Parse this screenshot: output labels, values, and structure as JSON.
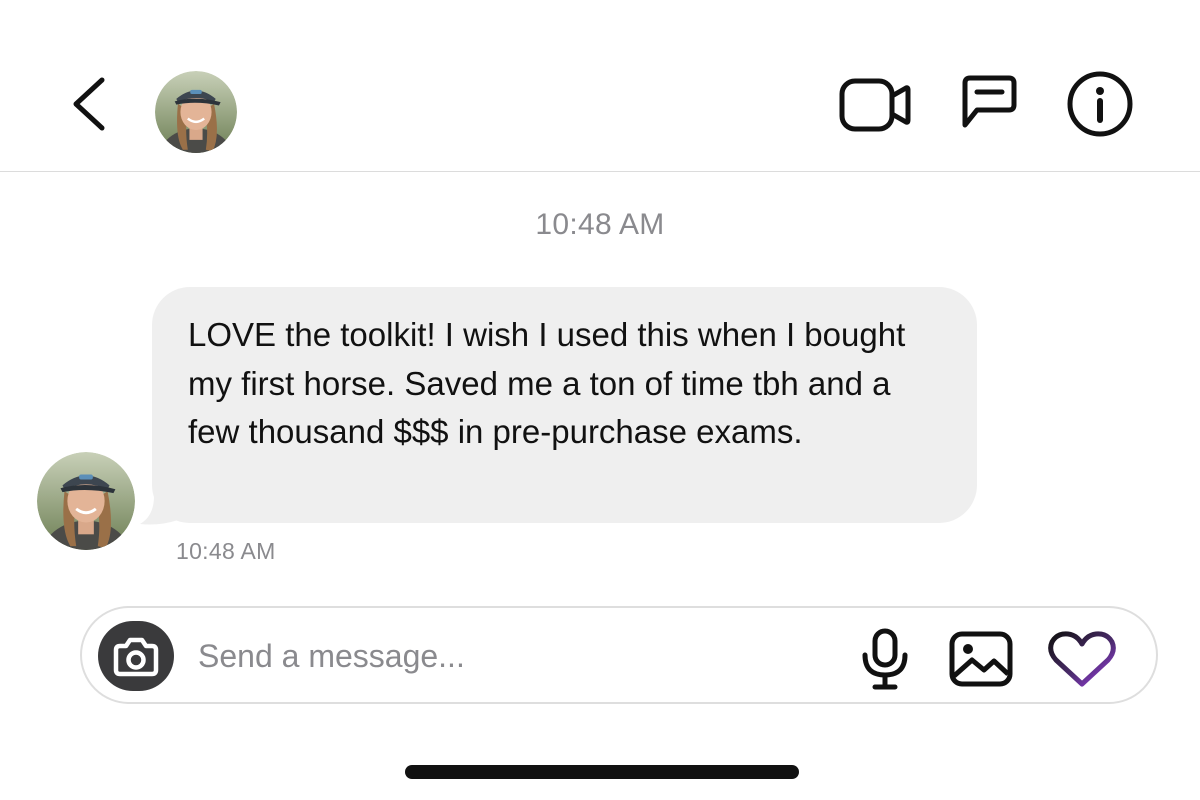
{
  "header": {
    "back_icon": "chevron-left-icon",
    "avatar_alt": "",
    "actions": [
      {
        "icon": "video-camera-icon"
      },
      {
        "icon": "message-thread-icon"
      },
      {
        "icon": "info-icon"
      }
    ]
  },
  "chat": {
    "timestamp": "10:48 AM",
    "messages": [
      {
        "direction": "incoming",
        "text": "LOVE the toolkit! I wish I used this when I bought my first horse. Saved me a ton of time tbh and a few thousand $$$ in pre-purchase exams.",
        "time": "10:48 AM"
      }
    ]
  },
  "composer": {
    "camera_icon": "camera-icon",
    "placeholder": "Send a message...",
    "value": "",
    "actions": [
      {
        "icon": "microphone-icon"
      },
      {
        "icon": "image-icon"
      },
      {
        "icon": "heart-icon"
      }
    ]
  },
  "colors": {
    "bubble": "#efefef",
    "timestamp": "#8a8a8e",
    "camera_button": "#3a3a3c",
    "heart_gradient_start": "#e0359a",
    "heart_gradient_end": "#7b3fe4"
  }
}
